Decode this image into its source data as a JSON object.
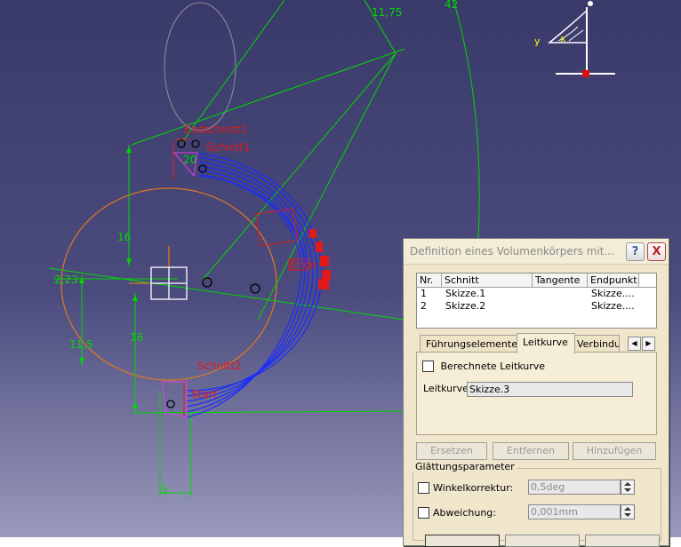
{
  "viewport": {
    "dimensions": [
      "11,75",
      "42",
      "16",
      "16",
      "2,23",
      "11,5",
      "20",
      "5"
    ],
    "labels": [
      "Endschnitt1",
      "Schnitt1",
      "Schnitt2",
      "Ende",
      "Start"
    ],
    "compass_axes": [
      "y",
      "x"
    ]
  },
  "dialog": {
    "title": "Definition eines Volumenkörpers mit...",
    "help_label": "?",
    "close_label": "X",
    "list": {
      "columns": [
        "Nr.",
        "Schnitt",
        "Tangente",
        "Endpunkt"
      ],
      "rows": [
        {
          "nr": "1",
          "schnitt": "Skizze.1",
          "tangente": "",
          "endpunkt": "Skizze...."
        },
        {
          "nr": "2",
          "schnitt": "Skizze.2",
          "tangente": "",
          "endpunkt": "Skizze...."
        }
      ]
    },
    "tabs": [
      "Führungselemente",
      "Leitkurve",
      "Verbindu"
    ],
    "active_tab": "Leitkurve",
    "computed_guide_label": "Berechnete Leitkurve",
    "computed_guide_checked": false,
    "guide_label": "Leitkurve:",
    "guide_value": "Skizze.3",
    "buttons": {
      "replace": "Ersetzen",
      "remove": "Entfernen",
      "add": "Hinzufügen"
    },
    "smoothing": {
      "title": "Glättungsparameter",
      "angle_label": "Winkelkorrektur:",
      "angle_value": "0,5deg",
      "angle_checked": false,
      "deviation_label": "Abweichung:",
      "deviation_value": "0,001mm",
      "deviation_checked": false
    }
  },
  "colors": {
    "background_top": "#3a3a6a",
    "sweep": "#1a2cff",
    "dimension": "#00d800",
    "constraint": "#e21a1a",
    "ellipse": "#e07820",
    "dialog_bg": "#f0e6cc"
  }
}
